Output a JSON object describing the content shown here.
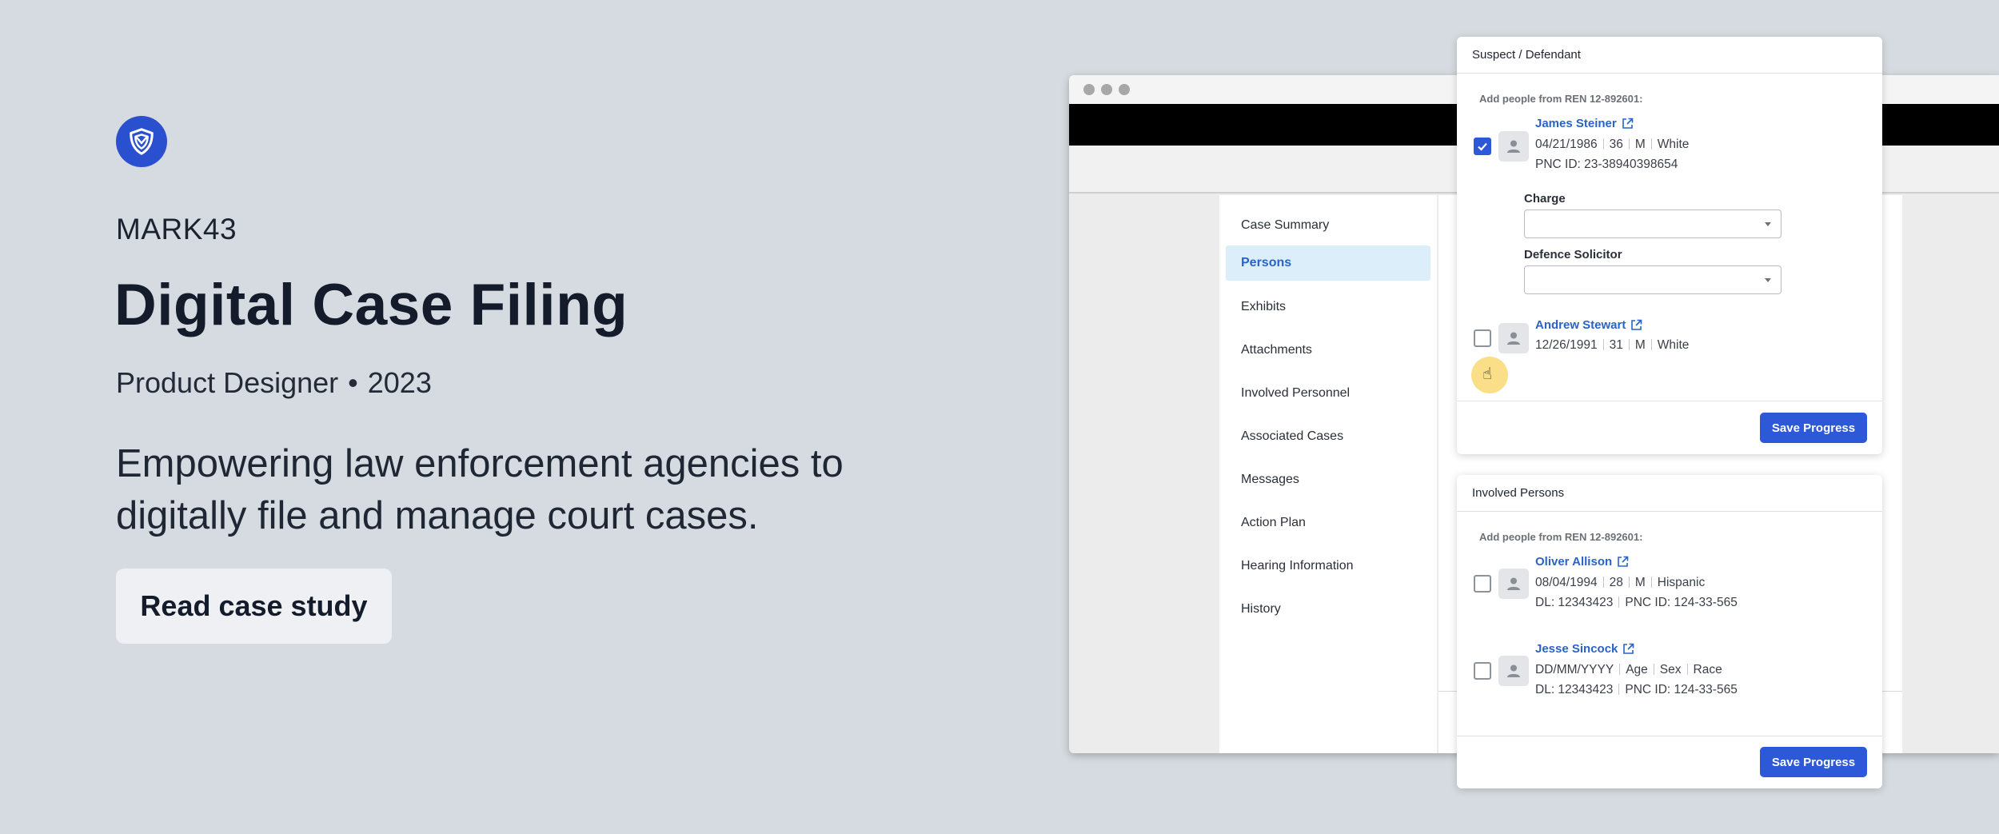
{
  "hero": {
    "brand": "MARK43",
    "title": "Digital Case Filing",
    "role": "Product Designer",
    "year": "2023",
    "description": "Empowering law enforcement agencies to digitally file and manage court cases.",
    "cta_label": "Read case study"
  },
  "colors": {
    "background": "#d5dbe0",
    "accent": "#2d58d8",
    "link": "#2a63c7",
    "nav_active_bg": "#ddeefb"
  },
  "sidenav": {
    "items": [
      {
        "label": "Case Summary",
        "active": false
      },
      {
        "label": "Persons",
        "active": true
      },
      {
        "label": "Exhibits",
        "active": false
      },
      {
        "label": "Attachments",
        "active": false
      },
      {
        "label": "Involved Personnel",
        "active": false
      },
      {
        "label": "Associated Cases",
        "active": false
      },
      {
        "label": "Messages",
        "active": false
      },
      {
        "label": "Action Plan",
        "active": false
      },
      {
        "label": "Hearing Information",
        "active": false
      },
      {
        "label": "History",
        "active": false
      }
    ]
  },
  "suspect_card": {
    "title": "Suspect / Defendant",
    "subheading": "Add people from REN 12-892601:",
    "persons": [
      {
        "name": "James Steiner",
        "checked": true,
        "dob": "04/21/1986",
        "age": "36",
        "sex": "M",
        "race": "White",
        "id_line": "PNC ID: 23-38940398654"
      },
      {
        "name": "Andrew Stewart",
        "checked": false,
        "dob": "12/26/1991",
        "age": "31",
        "sex": "M",
        "race": "White"
      }
    ],
    "charge_label": "Charge",
    "charge_value": "",
    "solicitor_label": "Defence Solicitor",
    "solicitor_value": "",
    "save_label": "Save Progress"
  },
  "involved_card": {
    "title": "Involved Persons",
    "subheading": "Add people from REN 12-892601:",
    "persons": [
      {
        "name": "Oliver Allison",
        "checked": false,
        "dob": "08/04/1994",
        "age": "28",
        "sex": "M",
        "race": "Hispanic",
        "dl": "DL: 12343423",
        "pnc": "PNC ID: 124-33-565"
      },
      {
        "name": "Jesse Sincock",
        "checked": false,
        "dob": "DD/MM/YYYY",
        "age": "Age",
        "sex": "Sex",
        "race": "Race",
        "dl": "DL: 12343423",
        "pnc": "PNC ID: 124-33-565"
      }
    ],
    "save_label": "Save Progress"
  },
  "icons": [
    "shield-logo-icon",
    "person-icon",
    "external-link-icon",
    "check-icon",
    "hand-pointer-icon",
    "chevron-down-icon"
  ]
}
